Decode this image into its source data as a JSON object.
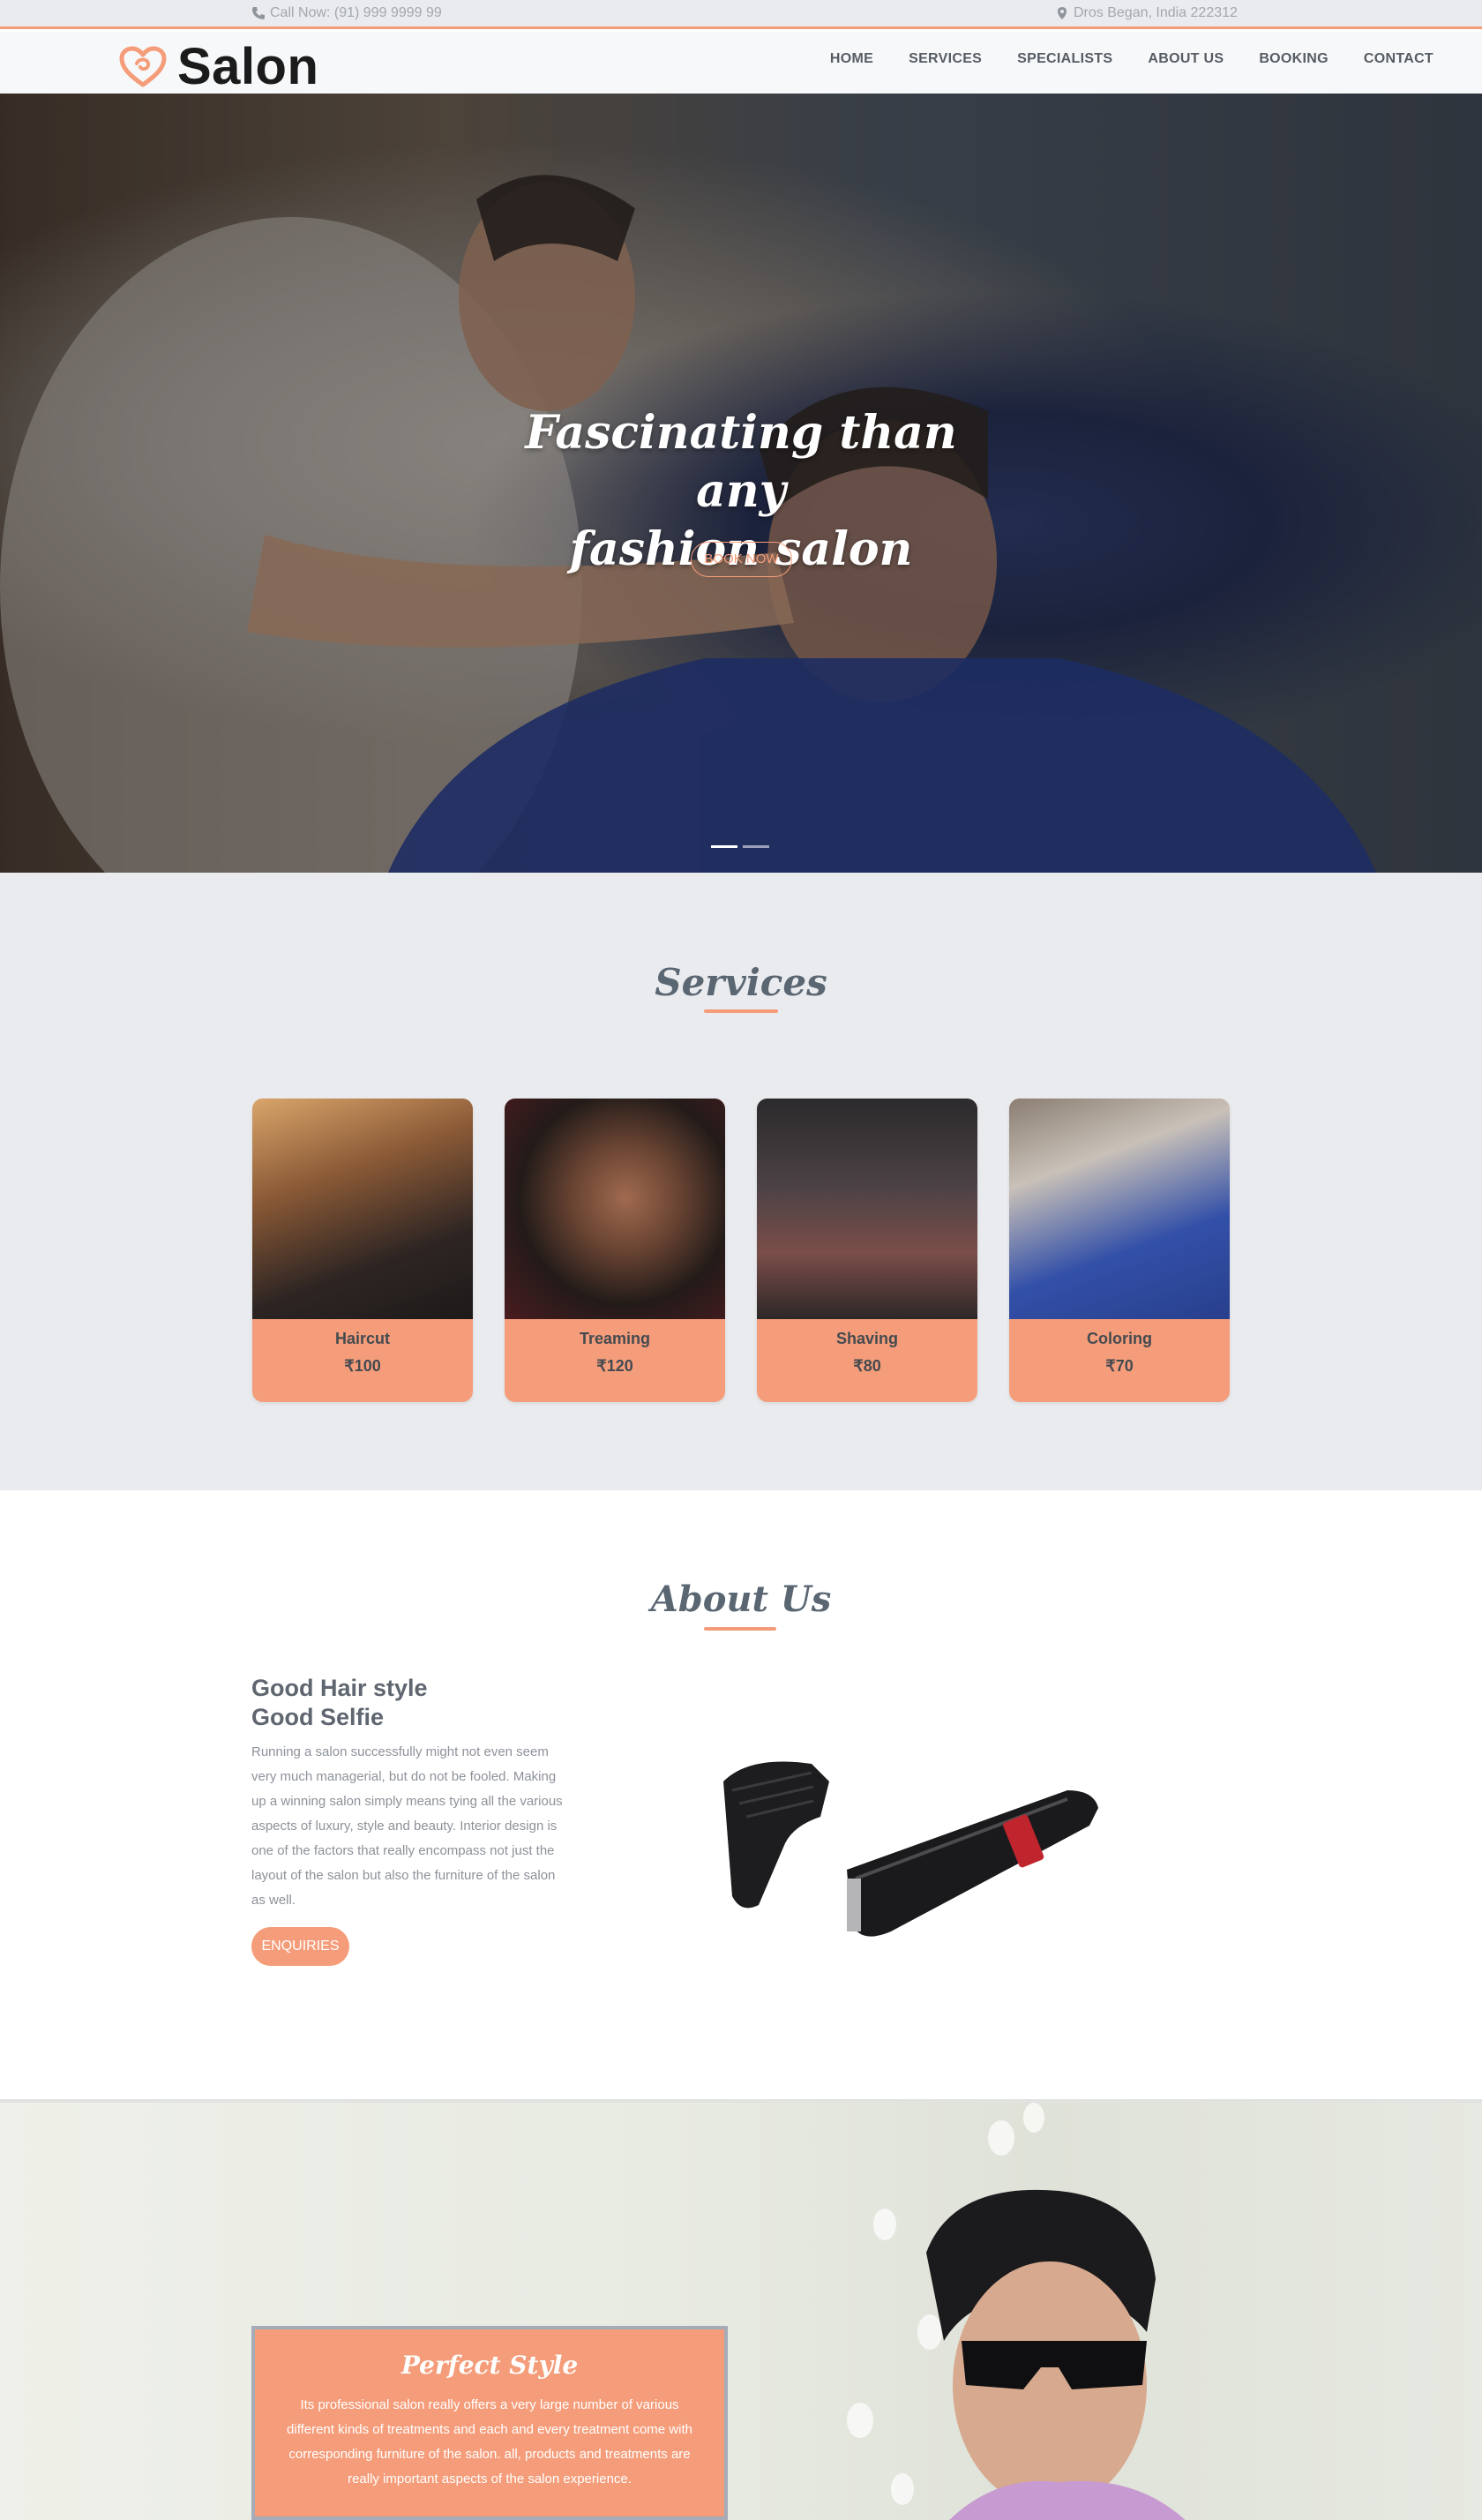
{
  "topbar": {
    "phone": "Call Now: (91) 999 9999 99",
    "address": "Dros Began, India 222312"
  },
  "brand": {
    "name": "Salon"
  },
  "nav": {
    "items": [
      "HOME",
      "SERVICES",
      "SPECIALISTS",
      "ABOUT US",
      "BOOKING",
      "CONTACT"
    ]
  },
  "hero": {
    "title_line1": "Fascinating than any",
    "title_line2": "fashion salon",
    "button": "BOOK NOW"
  },
  "services": {
    "title": "Services",
    "items": [
      {
        "name": "Haircut",
        "price": "₹100"
      },
      {
        "name": "Treaming",
        "price": "₹120"
      },
      {
        "name": "Shaving",
        "price": "₹80"
      },
      {
        "name": "Coloring",
        "price": "₹70"
      }
    ]
  },
  "about": {
    "title": "About Us",
    "heading_line1": "Good Hair style",
    "heading_line2": "Good Selfie",
    "body": "Running a salon successfully might not even seem very much managerial, but do not be fooled. Making up a winning salon simply means tying all the various aspects of luxury, style and beauty. Interior design is one of the factors that really encompass not just the layout of the salon but also the furniture of the salon as well.",
    "button": "ENQUIRIES"
  },
  "perfect": {
    "title": "Perfect Style",
    "body": "Its professional salon really offers a very large number of various different kinds of treatments and each and every treatment come with corresponding furniture of the salon. all, products and treatments are really important aspects of the salon experience."
  },
  "colors": {
    "accent": "#f59d7a",
    "heading": "#5a6672",
    "section_bg": "#e9ebee"
  },
  "icons": [
    "phone-icon",
    "map-marker-icon",
    "heart-logo-icon"
  ]
}
